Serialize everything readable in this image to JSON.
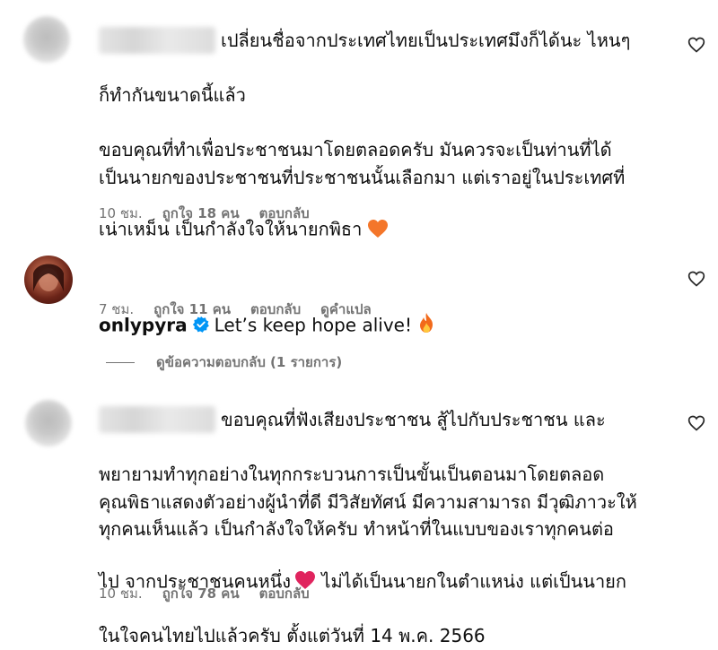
{
  "comments": [
    {
      "username": "",
      "text_line1": "เปลี่ยนชื่อจากประเทศไทยเป็นประเทศมึงก็ได้นะ ไหนๆ",
      "text_rest": "ก็ทำกันขนาดนี้แล้ว\n\nขอบคุณที่ทำเพื่อประชาชนมาโดยตลอดครับ มันควรจะเป็นท่านที่ได้\nเป็นนายกของประชาชนที่ประชาชนนั้นเลือกมา แต่เราอยู่ในประเทศที่\nเน่าเหม็น เป็นกำลังใจให้นายกพิธา",
      "emoji": "orange-heart-icon",
      "time": "10 ชม.",
      "likes": "ถูกใจ 18 คน",
      "reply": "ตอบกลับ"
    },
    {
      "username": "onlypyra",
      "text": "Let’s keep hope alive!",
      "emoji": "fire-icon",
      "time": "7 ชม.",
      "likes": "ถูกใจ 11 คน",
      "reply": "ตอบกลับ",
      "translate": "ดูคำแปล",
      "view_replies": "ดูข้อความตอบกลับ (1 รายการ)"
    },
    {
      "username": "",
      "text_line1": "ขอบคุณที่ฟังเสียงประชาชน สู้ไปกับประชาชน และ",
      "text_rest_a": "พยายามทำทุกอย่างในทุกกระบวนการเป็นขั้นเป็นตอนมาโดยตลอด\nคุณพิธาแสดงตัวอย่างผู้นำที่ดี มีวิสัยทัศน์ มีความสามารถ มีวุฒิภาวะให้\nทุกคนเห็นแล้ว เป็นกำลังใจให้ครับ ทำหน้าที่ในแบบของเราทุกคนต่อ\nไป จากประชาชนคนหนึ่ง",
      "emoji": "red-heart-icon",
      "text_rest_b": " ไม่ได้เป็นนายกในตำแหน่ง แต่เป็นนายก",
      "text_rest_c": "ในใจคนไทยไปแล้วครับ ตั้งแต่วันที่ 14 พ.ค. 2566",
      "time": "10 ชม.",
      "likes": "ถูกใจ 78 คน",
      "reply": "ตอบกลับ"
    }
  ],
  "colors": {
    "meta": "#737373",
    "verified": "#0095f6",
    "orange_heart": "#f4762a",
    "red_heart": "#e0245e"
  }
}
